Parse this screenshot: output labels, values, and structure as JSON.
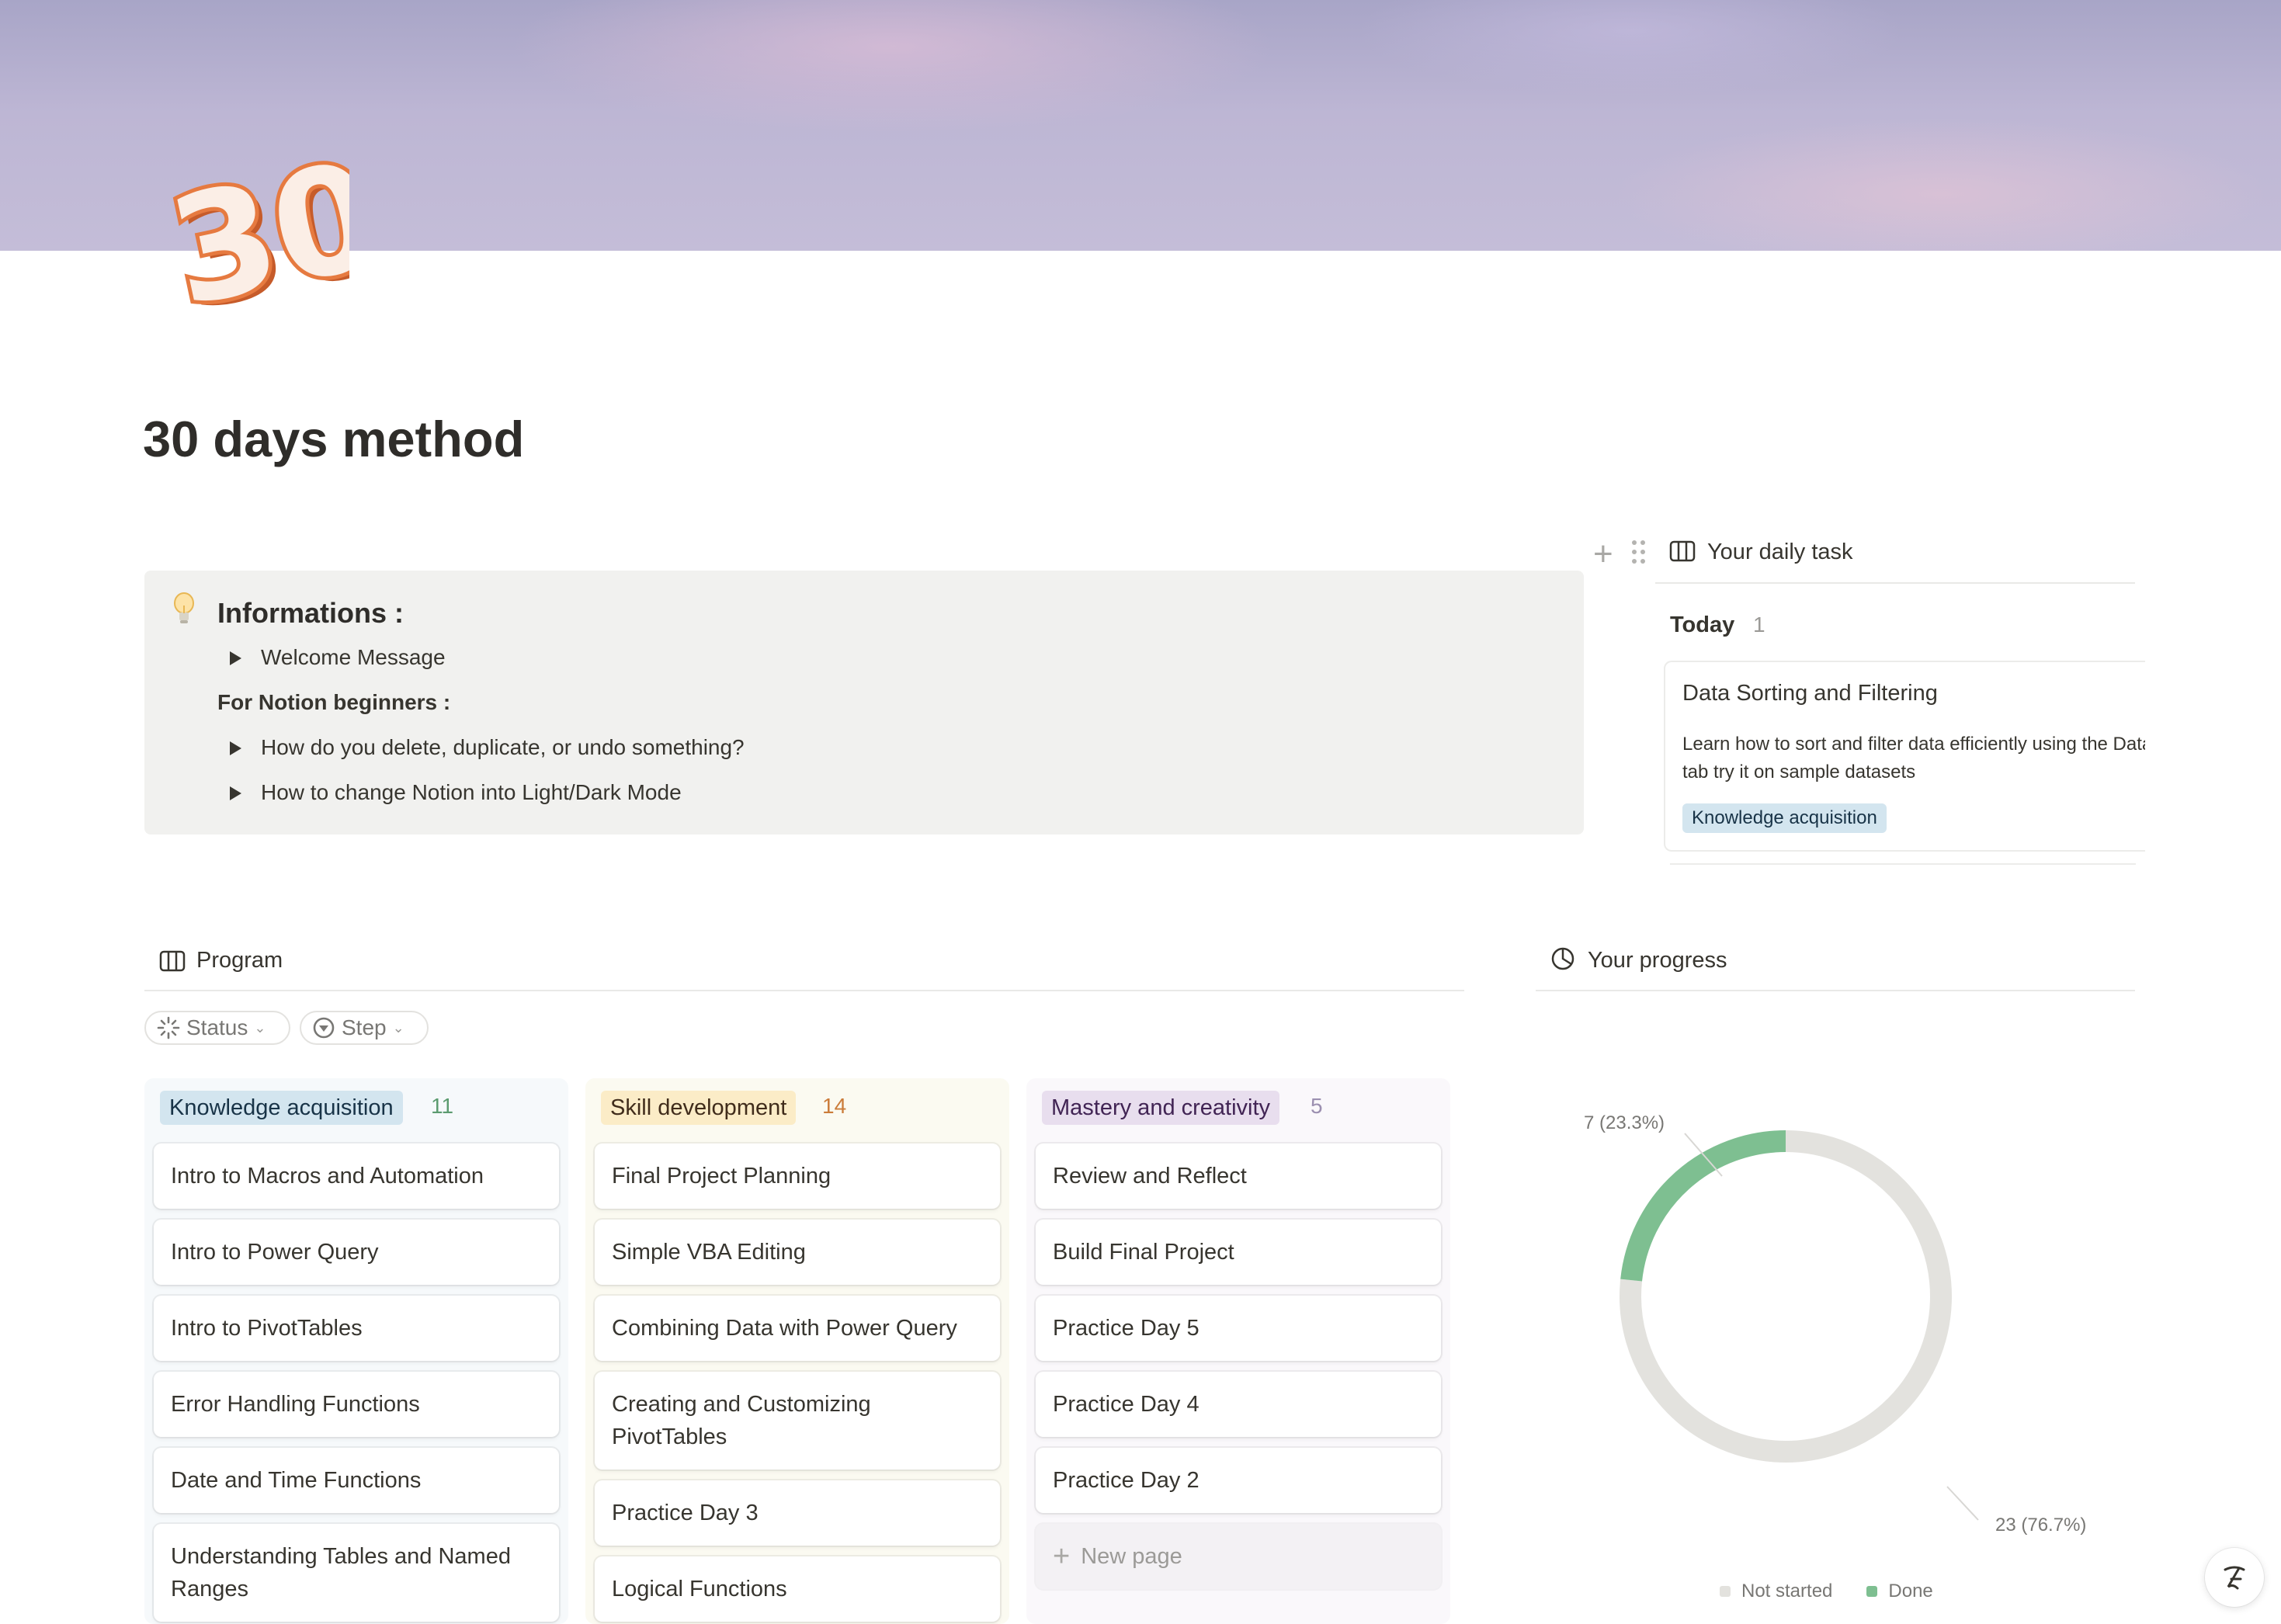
{
  "page": {
    "title": "30 days method",
    "icon": "number-30-icon"
  },
  "callout": {
    "icon": "lightbulb-icon",
    "title": "Informations :",
    "toggle_welcome": "Welcome Message",
    "beginners_heading": "For Notion beginners :",
    "toggle_delete": "How do you delete, duplicate, or undo something?",
    "toggle_mode": "How to change Notion into Light/Dark Mode"
  },
  "daily_task": {
    "title": "Your daily task",
    "group_label": "Today",
    "group_count": "1",
    "card": {
      "title": "Data Sorting and Filtering",
      "description": "Learn how to sort and filter data efficiently using the Data tab try it on sample datasets",
      "tag": "Knowledge acquisition"
    }
  },
  "program": {
    "title": "Program",
    "filters": {
      "status": "Status",
      "step": "Step"
    },
    "columns": [
      {
        "name": "Knowledge acquisition",
        "count": "11",
        "color": "#d3e5ef",
        "cards": [
          "Intro to Macros and Automation",
          "Intro to Power Query",
          "Intro to PivotTables",
          "Error Handling Functions",
          "Date and Time Functions",
          "Understanding Tables and Named Ranges"
        ]
      },
      {
        "name": "Skill development",
        "count": "14",
        "color": "#fbecc7",
        "cards": [
          "Final Project Planning",
          "Simple VBA Editing",
          "Combining Data with Power Query",
          "Creating and Customizing PivotTables",
          "Practice Day 3",
          "Logical Functions"
        ]
      },
      {
        "name": "Mastery and creativity",
        "count": "5",
        "color": "#e8deee",
        "cards": [
          "Review and Reflect",
          "Build Final Project",
          "Practice Day 5",
          "Practice Day 4",
          "Practice Day 2"
        ],
        "new_page": "New page"
      }
    ]
  },
  "progress": {
    "title": "Your progress",
    "label_done": "7 (23.3%)",
    "label_not_started": "23 (76.7%)",
    "legend": [
      {
        "name": "Not started",
        "color": "#e3e2de"
      },
      {
        "name": "Done",
        "color": "#7ebf91"
      }
    ]
  },
  "chart_data": {
    "type": "pie",
    "categories": [
      "Not started",
      "Done"
    ],
    "values": [
      23,
      7
    ],
    "title": "",
    "colors": [
      "#e3e2de",
      "#7ebf91"
    ],
    "legend_placement": "bottom"
  }
}
